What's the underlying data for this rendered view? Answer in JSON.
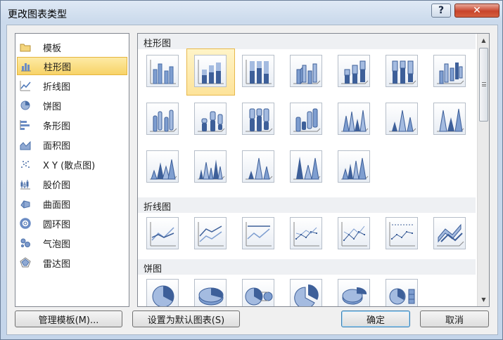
{
  "window": {
    "title": "更改图表类型",
    "help_label": "?",
    "close_label": "✕"
  },
  "categories": [
    {
      "label": "模板",
      "icon": "folder-icon"
    },
    {
      "label": "柱形图",
      "icon": "column-chart-icon",
      "selected": true
    },
    {
      "label": "折线图",
      "icon": "line-chart-icon"
    },
    {
      "label": "饼图",
      "icon": "pie-chart-icon"
    },
    {
      "label": "条形图",
      "icon": "bar-chart-icon"
    },
    {
      "label": "面积图",
      "icon": "area-chart-icon"
    },
    {
      "label": "X Y (散点图)",
      "icon": "scatter-chart-icon"
    },
    {
      "label": "股价图",
      "icon": "stock-chart-icon"
    },
    {
      "label": "曲面图",
      "icon": "surface-chart-icon"
    },
    {
      "label": "圆环图",
      "icon": "doughnut-chart-icon"
    },
    {
      "label": "气泡图",
      "icon": "bubble-chart-icon"
    },
    {
      "label": "雷达图",
      "icon": "radar-chart-icon"
    }
  ],
  "sections": {
    "column": {
      "title": "柱形图"
    },
    "line": {
      "title": "折线图"
    },
    "pie": {
      "title": "饼图"
    }
  },
  "buttons": {
    "manage_templates": "管理模板(M)...",
    "set_default": "设置为默认图表(S)",
    "ok": "确定",
    "cancel": "取消"
  }
}
